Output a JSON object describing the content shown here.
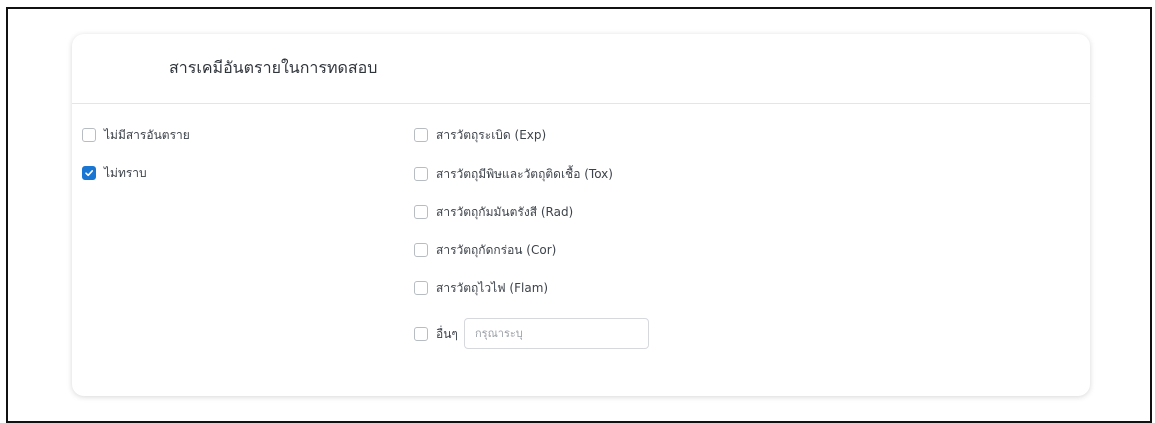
{
  "card": {
    "title": "สารเคมีอันตรายในการทดสอบ"
  },
  "left_options": [
    {
      "label": "ไม่มีสารอันตราย",
      "checked": false
    },
    {
      "label": "ไม่ทราบ",
      "checked": true
    }
  ],
  "right_options": [
    {
      "label": "สารวัตถุระเบิด (Exp)",
      "checked": false
    },
    {
      "label": "สารวัตถุมีพิษและวัตถุติดเชื้อ (Tox)",
      "checked": false
    },
    {
      "label": "สารวัตถุกัมมันตรังสี (Rad)",
      "checked": false
    },
    {
      "label": "สารวัตถุกัดกร่อน (Cor)",
      "checked": false
    },
    {
      "label": "สารวัตถุไวไฟ (Flam)",
      "checked": false
    }
  ],
  "other_option": {
    "label": "อื่นๆ",
    "checked": false,
    "placeholder": "กรุณาระบุ",
    "value": ""
  },
  "colors": {
    "accent": "#1976d2",
    "frame_border": "#111111"
  }
}
